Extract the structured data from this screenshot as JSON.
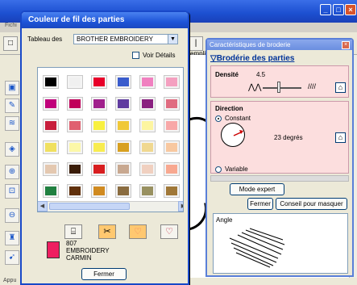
{
  "thread_dialog": {
    "title": "Couleur de fil des parties",
    "table_label": "Tableau des",
    "table_value": "BROTHER EMBROIDERY",
    "details_label": "Voir Détails",
    "selected": {
      "code": "807",
      "brand": "EMBROIDERY",
      "name": "CARMIN",
      "color": "#ee1e60"
    },
    "close_label": "Fermer",
    "swatch_colors": [
      [
        "#000000",
        "#f0f0f0",
        "#e8002a",
        "#3a5ccc",
        "#f080c0",
        "#f4a0c0"
      ],
      [
        "#c0007a",
        "#c0005a",
        "#a0208c",
        "#603ca0",
        "#8a2080",
        "#e06c80"
      ],
      [
        "#c81e3c",
        "#e06070",
        "#f8f040",
        "#f0c838",
        "#fdf5a0",
        "#f8a8a8"
      ],
      [
        "#f0e060",
        "#fcf8a8",
        "#f8ec50",
        "#d8a020",
        "#f0d890",
        "#f8c8a0"
      ],
      [
        "#e4c8b0",
        "#3a1c08",
        "#d81e20",
        "#c8a890",
        "#f0d0c0",
        "#f8a890"
      ],
      [
        "#208040",
        "#60300c",
        "#d08a20",
        "#8a6c40",
        "#989060",
        "#a07838"
      ]
    ]
  },
  "embroidery_dialog": {
    "title": "Caractéristiques de broderie",
    "heading": "Brodérie des parties",
    "density_label": "Densité",
    "density_value": "4.5",
    "direction_label": "Direction",
    "constant_label": "Constant",
    "variable_label": "Variable",
    "angle_value": "23 degrés",
    "expert_label": "Mode expert",
    "close_label": "Fermer",
    "advice_label": "Conseil pour masquer",
    "angle_label": "Angle"
  },
  "background": {
    "menu_fragment": "Fichi",
    "toolbar_fragment": "empli",
    "status_fragment": "Appu"
  }
}
